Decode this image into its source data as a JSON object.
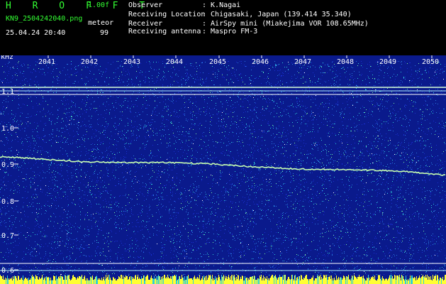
{
  "header": {
    "app_title": "H R O F F T",
    "version": "1.00f",
    "filename": "KN9_2504242040.png",
    "param_label": "meteor",
    "param_value": "99",
    "timestamp": "25.04.24 20:40",
    "info": [
      {
        "label": "Observer",
        "value": ": K.Nagai"
      },
      {
        "label": "Receiving Location",
        "value": ": Chigasaki, Japan (139.414 35.340)"
      },
      {
        "label": "Receiver",
        "value": ": AirSpy mini (Miakejima VOR 108.65MHz)"
      },
      {
        "label": "Receiving antenna",
        "value": ": Maspro FM-3"
      }
    ]
  },
  "plot": {
    "unit_label": "kHz",
    "time_ticks": [
      "2041",
      "2042",
      "2043",
      "2044",
      "2045",
      "2046",
      "2047",
      "2048",
      "2049",
      "2050"
    ],
    "freq_ticks": [
      "1.1",
      "1.0",
      "0.9",
      "0.8",
      "0.7",
      "0.6"
    ],
    "colors": {
      "background": "#0a1a8c",
      "noise": [
        "#1a2fd0",
        "#2a7ae0",
        "#30d0d8",
        "#7cf0a0",
        "#ffffff"
      ],
      "trace": "#c8ffb0",
      "floor": "#ffff33"
    }
  }
}
